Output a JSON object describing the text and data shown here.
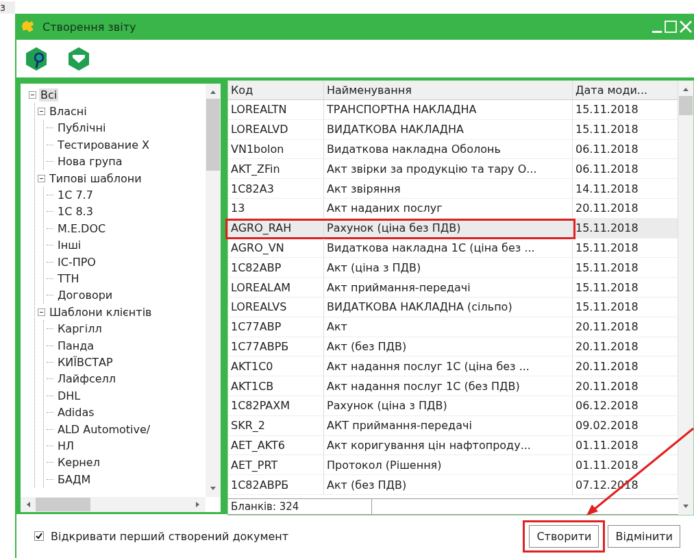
{
  "background_text": "з",
  "window": {
    "title": "Створення звіту"
  },
  "tree": [
    {
      "label": "Всі",
      "selected": true,
      "expanded": true,
      "children": [
        {
          "label": "Власні",
          "selected": false,
          "expanded": true,
          "children": [
            {
              "label": "Публічні",
              "selected": false
            },
            {
              "label": "Тестирование X",
              "selected": false
            },
            {
              "label": "Нова група",
              "selected": false
            }
          ]
        },
        {
          "label": "Типові шаблони",
          "selected": false,
          "expanded": true,
          "children": [
            {
              "label": "1С 7.7",
              "selected": false
            },
            {
              "label": "1С 8.3",
              "selected": false
            },
            {
              "label": "M.E.DOC",
              "selected": false
            },
            {
              "label": "Інші",
              "selected": false
            },
            {
              "label": "IC-ПРО",
              "selected": false
            },
            {
              "label": "ТТН",
              "selected": false
            },
            {
              "label": "Договори",
              "selected": false
            }
          ]
        },
        {
          "label": "Шаблони клієнтів",
          "selected": false,
          "expanded": true,
          "children": [
            {
              "label": "Каргілл",
              "selected": false
            },
            {
              "label": "Панда",
              "selected": false
            },
            {
              "label": "КИЇВСТАР",
              "selected": false
            },
            {
              "label": "Лайфселл",
              "selected": false
            },
            {
              "label": "DHL",
              "selected": false
            },
            {
              "label": "Adidas",
              "selected": false
            },
            {
              "label": "ALD Automotive/",
              "selected": false
            },
            {
              "label": "НЛ",
              "selected": false
            },
            {
              "label": "Кернел",
              "selected": false
            },
            {
              "label": "БАДМ",
              "selected": false
            }
          ]
        }
      ]
    }
  ],
  "table": {
    "columns": [
      "Код",
      "Найменування",
      "Дата моди..."
    ],
    "rows": [
      {
        "cells": [
          "LOREALTN",
          "ТРАНСПОРТНА НАКЛАДНА",
          "15.11.2018"
        ],
        "selected": false,
        "annotated": false
      },
      {
        "cells": [
          "LOREALVD",
          "ВИДАТКОВА НАКЛАДНА",
          "15.11.2018"
        ],
        "selected": false,
        "annotated": false
      },
      {
        "cells": [
          "VN1bolon",
          "Видаткова накладна Оболонь",
          "06.11.2018"
        ],
        "selected": false,
        "annotated": false
      },
      {
        "cells": [
          "AKT_ZFin",
          "Акт звірки за продукцію та тару О...",
          "06.11.2018"
        ],
        "selected": false,
        "annotated": false
      },
      {
        "cells": [
          "1C82A3",
          "Акт звіряння",
          "14.11.2018"
        ],
        "selected": false,
        "annotated": false
      },
      {
        "cells": [
          "13",
          "Акт наданих послуг",
          "20.11.2018"
        ],
        "selected": false,
        "annotated": false
      },
      {
        "cells": [
          "AGRO_RAH",
          "Рахунок (ціна без ПДВ)",
          "15.11.2018"
        ],
        "selected": true,
        "annotated": true
      },
      {
        "cells": [
          "AGRO_VN",
          "Видаткова накладна 1С (ціна без ...",
          "15.11.2018"
        ],
        "selected": false,
        "annotated": false
      },
      {
        "cells": [
          "1C82ABP",
          "Акт (ціна з ПДВ)",
          "15.11.2018"
        ],
        "selected": false,
        "annotated": false
      },
      {
        "cells": [
          "LOREALAM",
          "Акт приймання-передачі",
          "15.11.2018"
        ],
        "selected": false,
        "annotated": false
      },
      {
        "cells": [
          "LOREALVS",
          "ВИДАТКОВА НАКЛАДНА (сільпо)",
          "15.11.2018"
        ],
        "selected": false,
        "annotated": false
      },
      {
        "cells": [
          "1C77ABP",
          "Акт",
          "20.11.2018"
        ],
        "selected": false,
        "annotated": false
      },
      {
        "cells": [
          "1C77ABPБ",
          "Акт (без ПДВ)",
          "20.11.2018"
        ],
        "selected": false,
        "annotated": false
      },
      {
        "cells": [
          "AKT1C0",
          "Акт надання послуг 1С (ціна без ...",
          "20.11.2018"
        ],
        "selected": false,
        "annotated": false
      },
      {
        "cells": [
          "AKT1CB",
          "Акт надання послуг 1С (без ПДВ)",
          "20.11.2018"
        ],
        "selected": false,
        "annotated": false
      },
      {
        "cells": [
          "1C82PAXM",
          "Рахунок (ціна з ПДВ)",
          "06.12.2018"
        ],
        "selected": false,
        "annotated": false
      },
      {
        "cells": [
          "SKR_2",
          "АКТ приймання-передачі",
          "09.02.2018"
        ],
        "selected": false,
        "annotated": false
      },
      {
        "cells": [
          "AET_AKT6",
          "Акт коригування цін нафтопроду...",
          "01.11.2018"
        ],
        "selected": false,
        "annotated": false
      },
      {
        "cells": [
          "AET_PRT",
          "Протокол (Рішення)",
          "01.11.2018"
        ],
        "selected": false,
        "annotated": false
      },
      {
        "cells": [
          "1C82ABPБ",
          "Акт (без ПДВ)",
          "07.12.2018"
        ],
        "selected": false,
        "annotated": false
      }
    ],
    "footer": "Бланків: 324"
  },
  "open_first": {
    "label": "Відкривати перший створений документ",
    "checked": true
  },
  "buttons": [
    {
      "label": "Створити",
      "annotated": true
    },
    {
      "label": "Відмінити",
      "annotated": false
    }
  ]
}
